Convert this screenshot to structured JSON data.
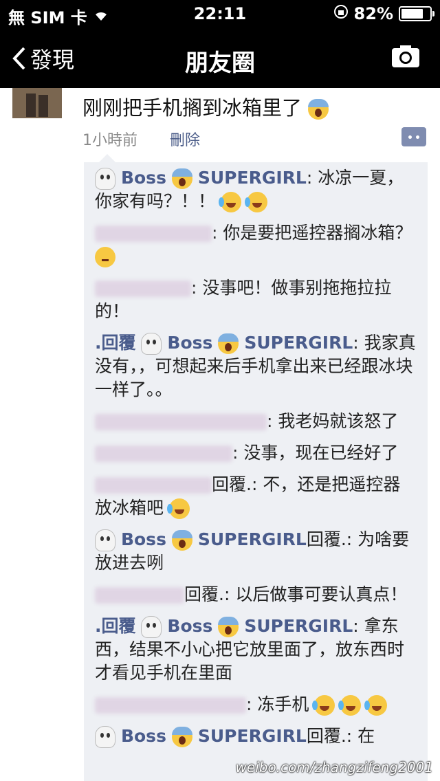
{
  "status_bar": {
    "carrier": "無 SIM 卡",
    "time": "22:11",
    "battery": "82%",
    "battery_level": 0.82
  },
  "nav": {
    "back_label": "發現",
    "title": "朋友圈"
  },
  "post": {
    "text": "刚刚把手机搁到冰箱里了",
    "time": "1小時前",
    "delete_label": "刪除"
  },
  "comments": [
    {
      "name": "Boss",
      "name2": "SUPERGIRL",
      "text": ": 冰凉一夏，你家有吗？！！"
    },
    {
      "name": "",
      "text": ": 你是要把遥控器搁冰箱？"
    },
    {
      "name": "",
      "text": ": 没事吧！做事别拖拖拉拉的！"
    },
    {
      "prefix": ".回覆",
      "name": "Boss",
      "name2": "SUPERGIRL",
      "text": ": 我家真没有，，可想起来后手机拿出来已经跟冰块一样了。。"
    },
    {
      "name": "",
      "text": ": 我老妈就该怒了"
    },
    {
      "name": "",
      "text": ": 没事，现在已经好了"
    },
    {
      "name": "",
      "prefix": "回覆.",
      "text": ": 不，还是把遥控器放冰箱吧"
    },
    {
      "name": "Boss",
      "name2": "SUPERGIRL",
      "prefix": "回覆.",
      "text": ": 为啥要放进去咧"
    },
    {
      "name": "",
      "prefix": "回覆.",
      "text": ": 以后做事可要认真点！"
    },
    {
      "prefix": ".回覆",
      "name": "Boss",
      "name2": "SUPERGIRL",
      "text": ": 拿东西，结果不小心把它放里面了，放东西时才看见手机在里面"
    },
    {
      "name": "",
      "text": ": 冻手机"
    },
    {
      "name": "Boss",
      "name2": "SUPERGIRL",
      "prefix": "回覆.",
      "text": ": 在"
    }
  ],
  "watermark": "weibo.com/zhangzifeng2001"
}
